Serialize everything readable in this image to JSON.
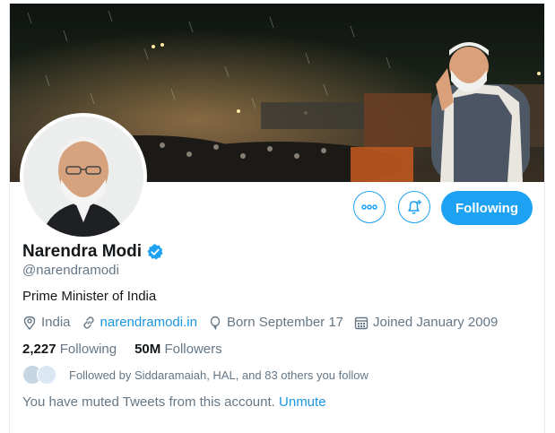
{
  "profile": {
    "name": "Narendra Modi",
    "handle": "@narendramodi",
    "bio": "Prime Minister of India",
    "location": "India",
    "website": "narendramodi.in",
    "born": "Born September 17",
    "joined": "Joined January 2009"
  },
  "stats": {
    "following_count": "2,227",
    "following_label": "Following",
    "followers_count": "50M",
    "followers_label": "Followers"
  },
  "actions": {
    "following_button": "Following"
  },
  "followed_by": "Followed by Siddaramaiah, HAL, and 83 others you follow",
  "muted": {
    "text": "You have muted Tweets from this account.",
    "unmute": "Unmute"
  },
  "colors": {
    "accent": "#1da1f2",
    "link": "#1b95e0",
    "secondary_text": "#657786"
  },
  "icons": [
    "more-icon",
    "notification-bell-icon",
    "verified-badge-icon",
    "location-icon",
    "link-icon",
    "birthday-icon",
    "calendar-icon"
  ]
}
